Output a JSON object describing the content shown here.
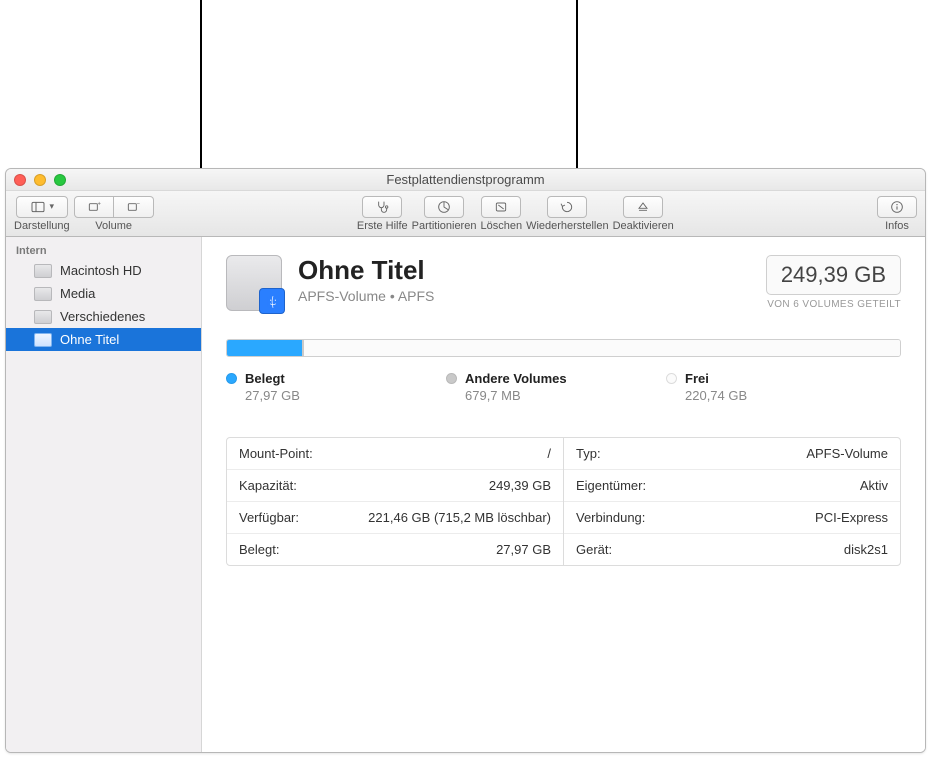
{
  "window": {
    "title": "Festplattendienstprogramm"
  },
  "toolbar": {
    "view_label": "Darstellung",
    "volume_label": "Volume",
    "first_aid": "Erste Hilfe",
    "partition": "Partitionieren",
    "erase": "Löschen",
    "restore": "Wiederherstellen",
    "unmount": "Deaktivieren",
    "info": "Infos"
  },
  "sidebar": {
    "section": "Intern",
    "items": [
      {
        "label": "Macintosh HD",
        "selected": false
      },
      {
        "label": "Media",
        "selected": false
      },
      {
        "label": "Verschiedenes",
        "selected": false
      },
      {
        "label": "Ohne Titel",
        "selected": true
      }
    ]
  },
  "volume": {
    "name": "Ohne Titel",
    "subtitle": "APFS-Volume • APFS",
    "size": "249,39 GB",
    "shared_note": "VON 6 VOLUMES GETEILT"
  },
  "usage": {
    "used_label": "Belegt",
    "used_value": "27,97 GB",
    "used_pct": 11.2,
    "other_label": "Andere Volumes",
    "other_value": "679,7 MB",
    "other_pct": 0.3,
    "free_label": "Frei",
    "free_value": "220,74 GB",
    "free_pct": 88.5
  },
  "details": {
    "left": [
      {
        "k": "Mount-Point:",
        "v": "/"
      },
      {
        "k": "Kapazität:",
        "v": "249,39 GB"
      },
      {
        "k": "Verfügbar:",
        "v": "221,46 GB (715,2 MB löschbar)"
      },
      {
        "k": "Belegt:",
        "v": "27,97 GB"
      }
    ],
    "right": [
      {
        "k": "Typ:",
        "v": "APFS-Volume"
      },
      {
        "k": "Eigentümer:",
        "v": "Aktiv"
      },
      {
        "k": "Verbindung:",
        "v": "PCI-Express"
      },
      {
        "k": "Gerät:",
        "v": "disk2s1"
      }
    ]
  }
}
